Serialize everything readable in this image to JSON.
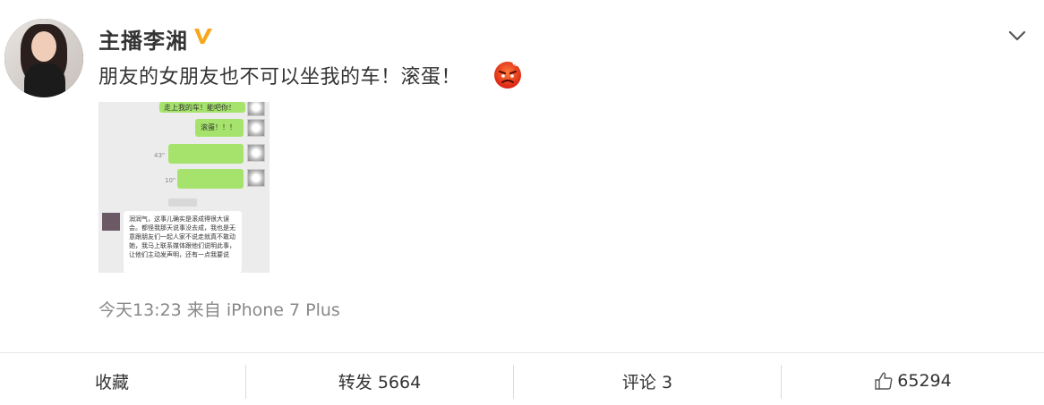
{
  "post": {
    "username": "主播李湘",
    "text": "朋友的女朋友也不可以坐我的车！滚蛋！",
    "meta": "今天13:23 来自 iPhone 7 Plus"
  },
  "thumbnail": {
    "top_bubble": "走上我的车！能吧你！",
    "bubble_2": "滚蛋！！！",
    "secs_1": "43\"",
    "secs_2": "10\"",
    "message": "润润气，这事儿确实是滚成得很大误会。都怪我那天说事没去成，我也是无意跟朋友们一起人家不说走就真不敢动她，我马上联系媒体跟他们说明此事，让他们主动发声明，还有一点我要说"
  },
  "actions": {
    "favorite": "收藏",
    "repost": "转发 5664",
    "comment": "评论 3",
    "like": "65294"
  },
  "colors": {
    "verified": "#f7a71b",
    "bubble_green": "#a6e36c",
    "meta_gray": "#888888"
  },
  "icons": [
    "verified-badge-icon",
    "chevron-down-icon",
    "angry-face-emoji-icon",
    "thumbs-up-icon"
  ]
}
